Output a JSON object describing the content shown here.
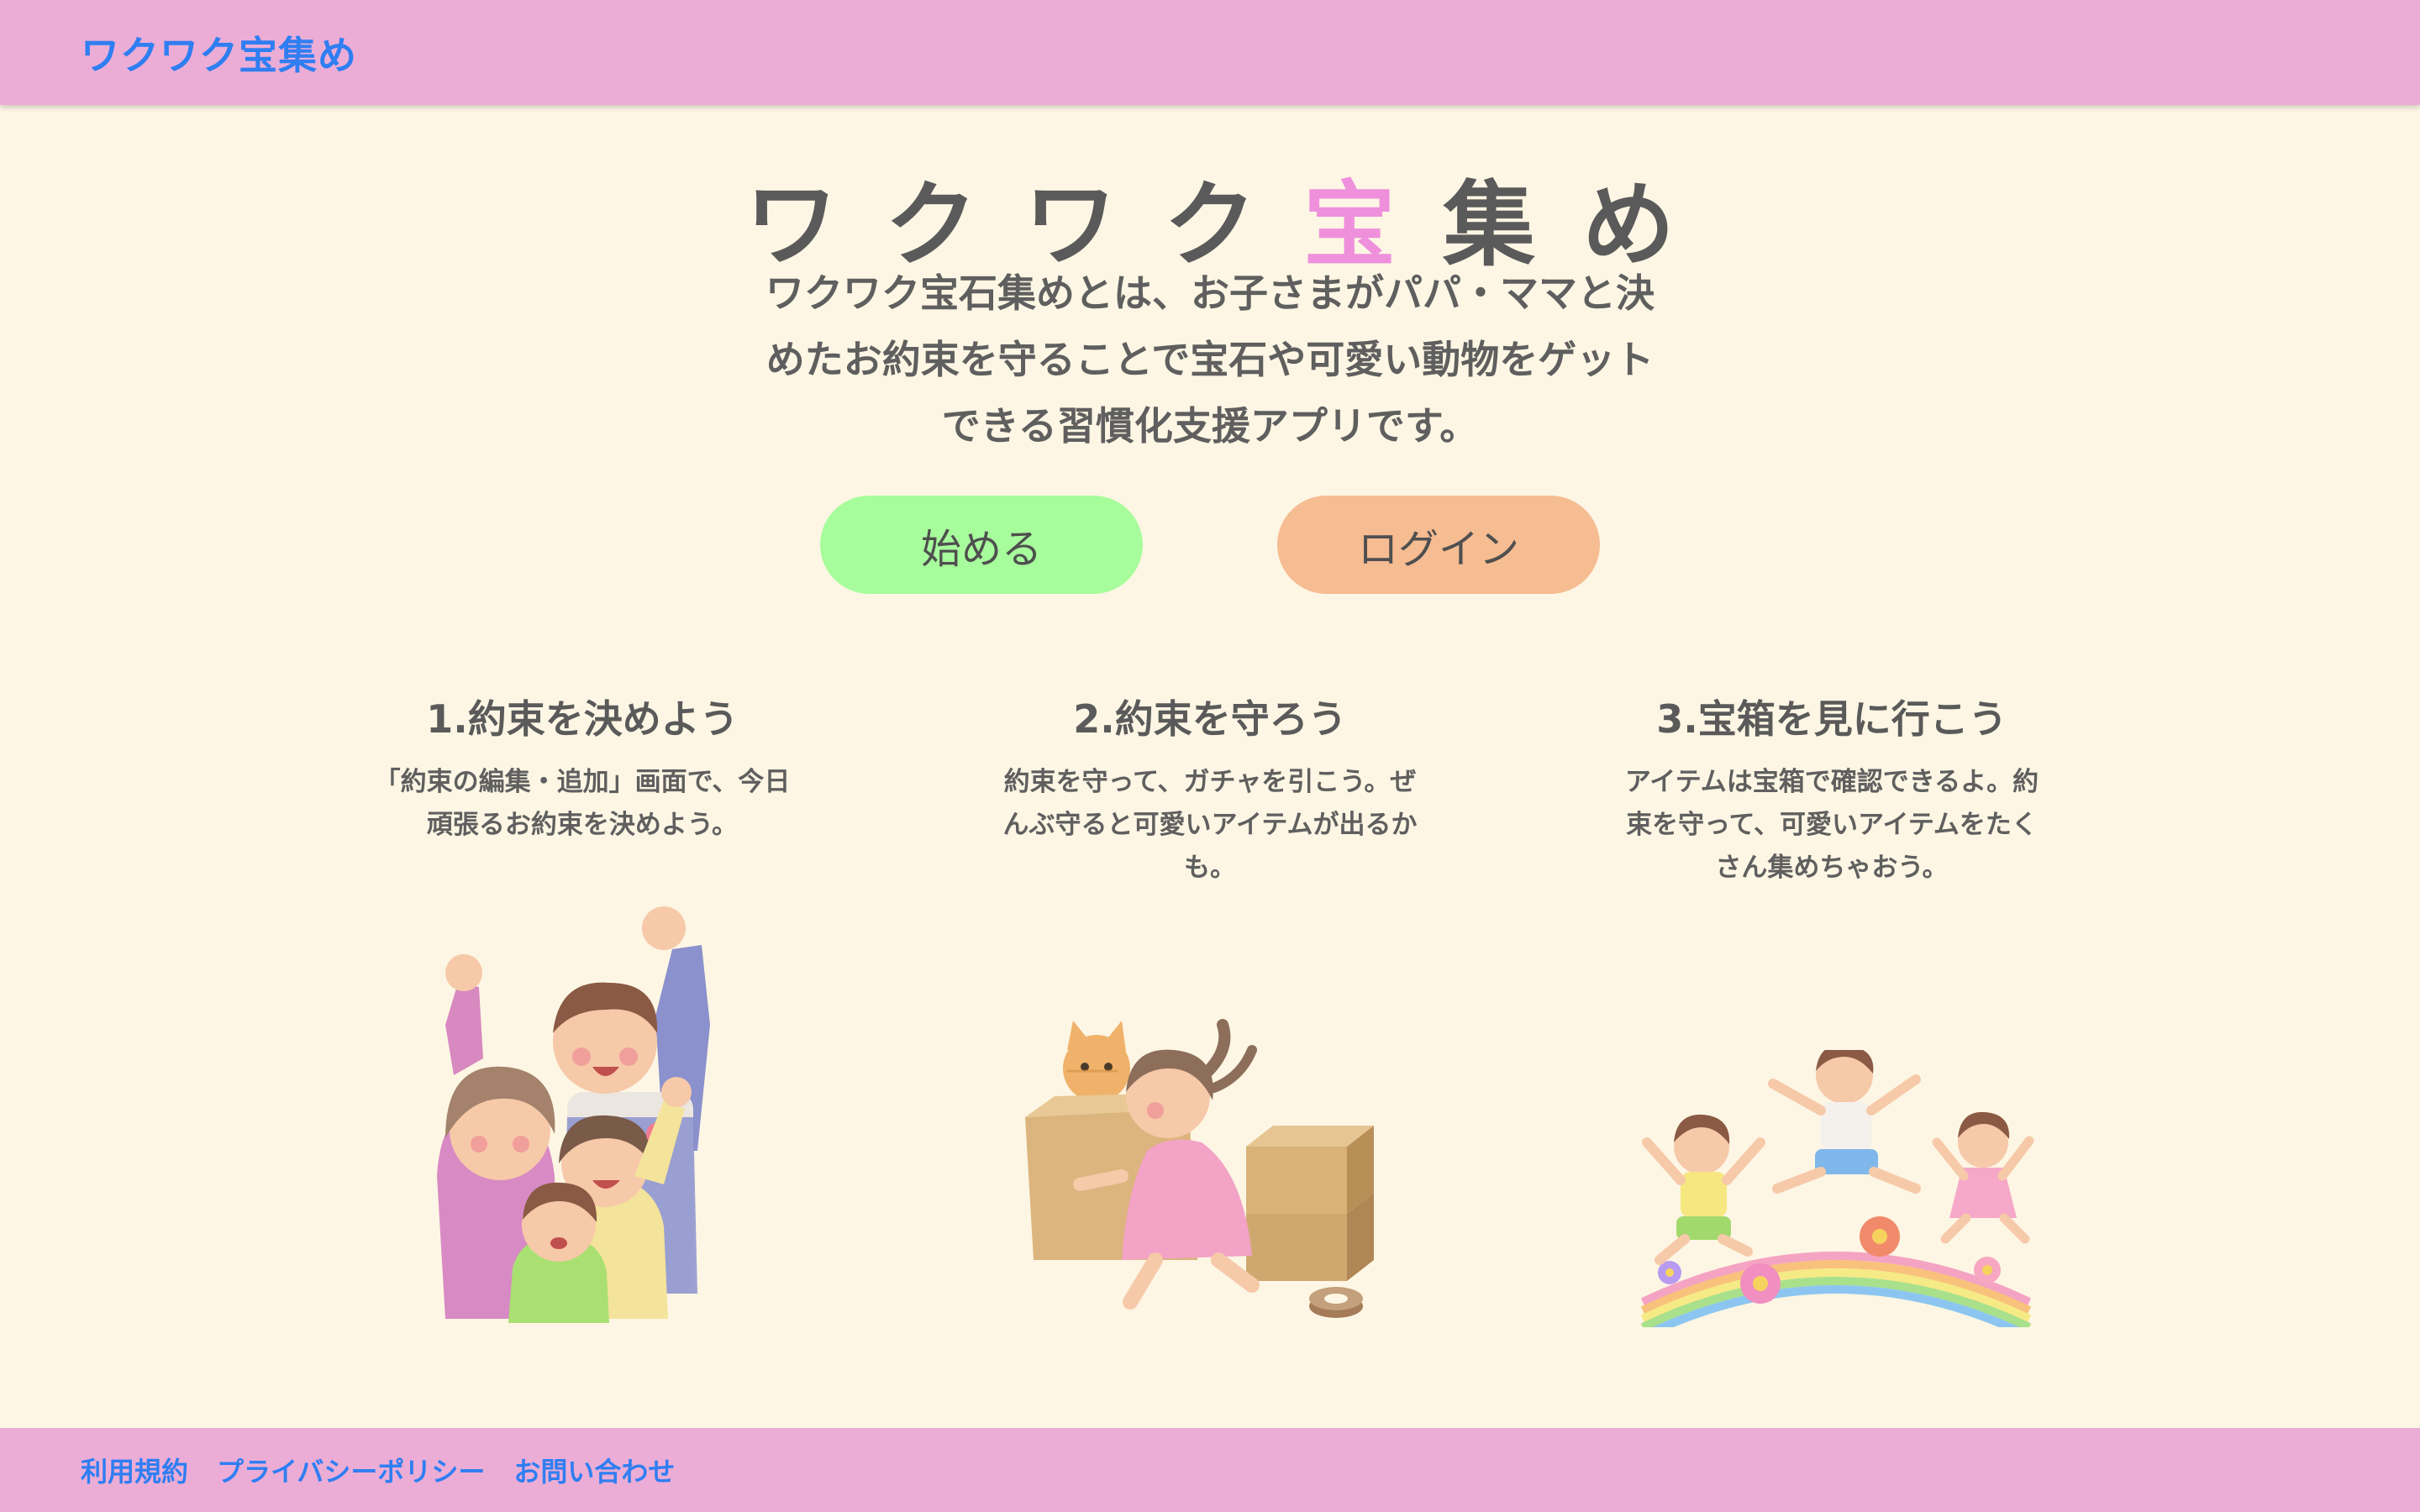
{
  "header": {
    "brand": "ワクワク宝集め"
  },
  "hero": {
    "title_part1": "ワクワク",
    "title_accent": "宝",
    "title_part2": "集め",
    "description": "ワクワク宝石集めとは、お子さまがパパ・ママと決めたお約束を守ることで宝石や可愛い動物をゲットできる習慣化支援アプリです。",
    "start_button": "始める",
    "login_button": "ログイン"
  },
  "steps": [
    {
      "title": "1.約束を決めよう",
      "text": "「約束の編集・追加」画面で、今日頑張るお約束を決めよう。",
      "illustration": "family-cheering-illustration"
    },
    {
      "title": "2.約束を守ろう",
      "text": "約束を守って、ガチャを引こう。ぜんぶ守ると可愛いアイテムが出るかも。",
      "illustration": "girl-carrying-box-with-cat-illustration"
    },
    {
      "title": "3.宝箱を見に行こう",
      "text": "アイテムは宝箱で確認できるよ。約束を守って、可愛いアイテムをたくさん集めちゃおう。",
      "illustration": "children-jumping-on-rainbow-illustration"
    }
  ],
  "footer": {
    "links": [
      "利用規約",
      "プライバシーポリシー",
      "お問い合わせ"
    ]
  },
  "colors": {
    "background": "#fdf6e4",
    "bar": "#ebadd6",
    "link": "#2f7ef2",
    "accent": "#ee90dc",
    "start_button": "#a7fd9c",
    "login_button": "#f6bc92"
  }
}
